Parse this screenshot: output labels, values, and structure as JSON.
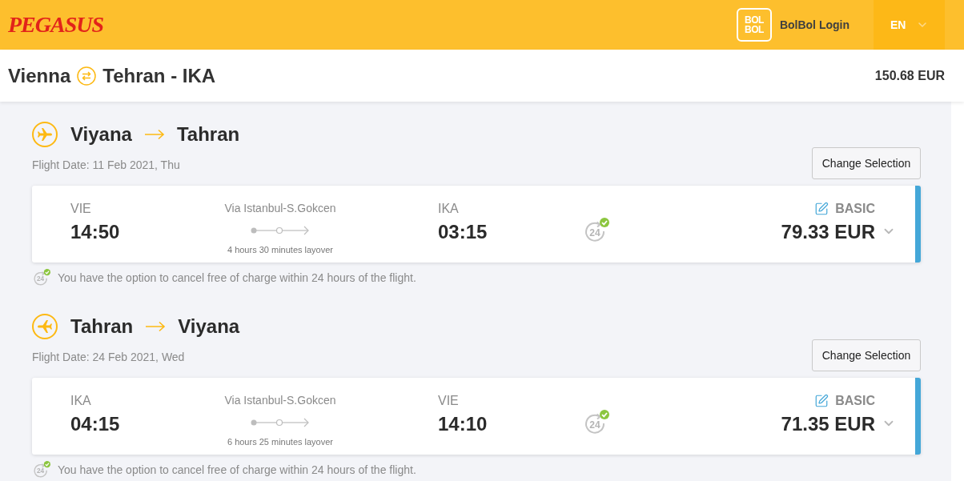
{
  "header": {
    "logo": "PEGASUS",
    "loyalty": {
      "logo_lines": [
        "BOL",
        "BOL"
      ],
      "label": "BolBol Login"
    },
    "language": {
      "label": "EN",
      "expanded": false
    }
  },
  "summary": {
    "origin": "Vienna",
    "destination": "Tehran - IKA",
    "total": "150.68 EUR"
  },
  "legs": [
    {
      "kind": "outbound",
      "from": "Viyana",
      "to": "Tahran",
      "date": "Flight Date: 11 Feb 2021, Thu",
      "change_button": "Change Selection",
      "flight": {
        "selected": true,
        "departure": {
          "code": "VIE",
          "time": "14:50"
        },
        "via": "Via Istanbul-S.Gokcen",
        "layover": "4 hours 30 minutes layover",
        "arrival": {
          "code": "IKA",
          "time": "03:15"
        },
        "cancel_badge": "24",
        "fare": "BASIC",
        "price": "79.33 EUR",
        "expanded": false
      },
      "note": {
        "badge": "24",
        "text": "You have the option to cancel free of charge within 24 hours of the flight."
      }
    },
    {
      "kind": "return",
      "from": "Tahran",
      "to": "Viyana",
      "date": "Flight Date: 24 Feb 2021, Wed",
      "change_button": "Change Selection",
      "flight": {
        "selected": true,
        "departure": {
          "code": "IKA",
          "time": "04:15"
        },
        "via": "Via Istanbul-S.Gokcen",
        "layover": "6 hours 25 minutes layover",
        "arrival": {
          "code": "VIE",
          "time": "14:10"
        },
        "cancel_badge": "24",
        "fare": "BASIC",
        "price": "71.35 EUR",
        "expanded": false
      },
      "note": {
        "badge": "24",
        "text": "You have the option to cancel free of charge within 24 hours of the flight."
      }
    }
  ]
}
